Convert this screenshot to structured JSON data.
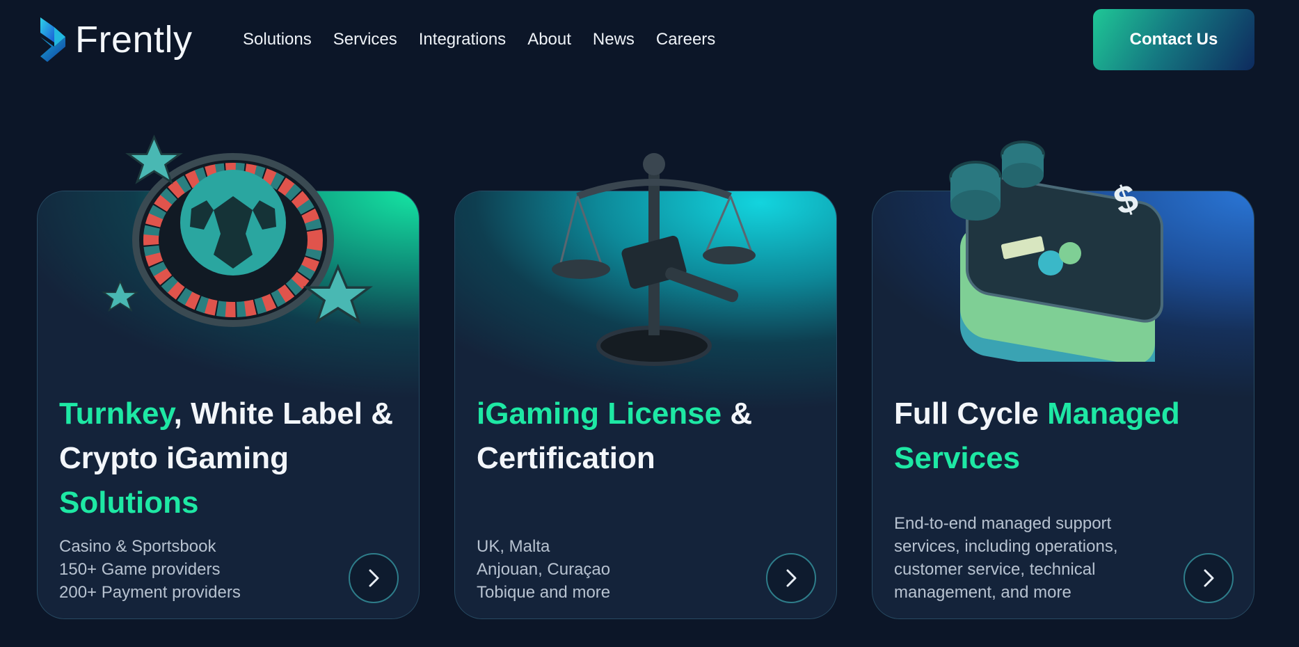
{
  "brand": {
    "name": "Frently",
    "logo_icon": "frently-logo-icon"
  },
  "nav": {
    "items": [
      {
        "label": "Solutions"
      },
      {
        "label": "Services"
      },
      {
        "label": "Integrations"
      },
      {
        "label": "About"
      },
      {
        "label": "News"
      },
      {
        "label": "Careers"
      }
    ],
    "contact_label": "Contact Us"
  },
  "colors": {
    "background": "#0c1628",
    "accent": "#1ee8a4",
    "card": "#14233a"
  },
  "cards": [
    {
      "title_parts": [
        "Turnkey",
        ", White Label & Crypto iGaming ",
        "Solutions"
      ],
      "desc_lines": [
        "Casino & Sportsbook",
        "150+ Game providers",
        "200+ Payment providers"
      ],
      "illustration": "roulette-soccer-ball-icon",
      "arrow_icon": "chevron-right-icon"
    },
    {
      "title_parts": [
        "iGaming License",
        " & Certification"
      ],
      "desc_lines": [
        "UK, Malta",
        "Anjouan, Curaçao",
        "Tobique and more"
      ],
      "illustration": "scales-gavel-icon",
      "arrow_icon": "chevron-right-icon"
    },
    {
      "title_parts": [
        "Full Cycle ",
        "Managed Services"
      ],
      "desc_lines": [
        "End-to-end managed support",
        "services, including operations,",
        "customer service, technical",
        "management, and more"
      ],
      "illustration": "wallet-card-coins-icon",
      "arrow_icon": "chevron-right-icon"
    }
  ]
}
